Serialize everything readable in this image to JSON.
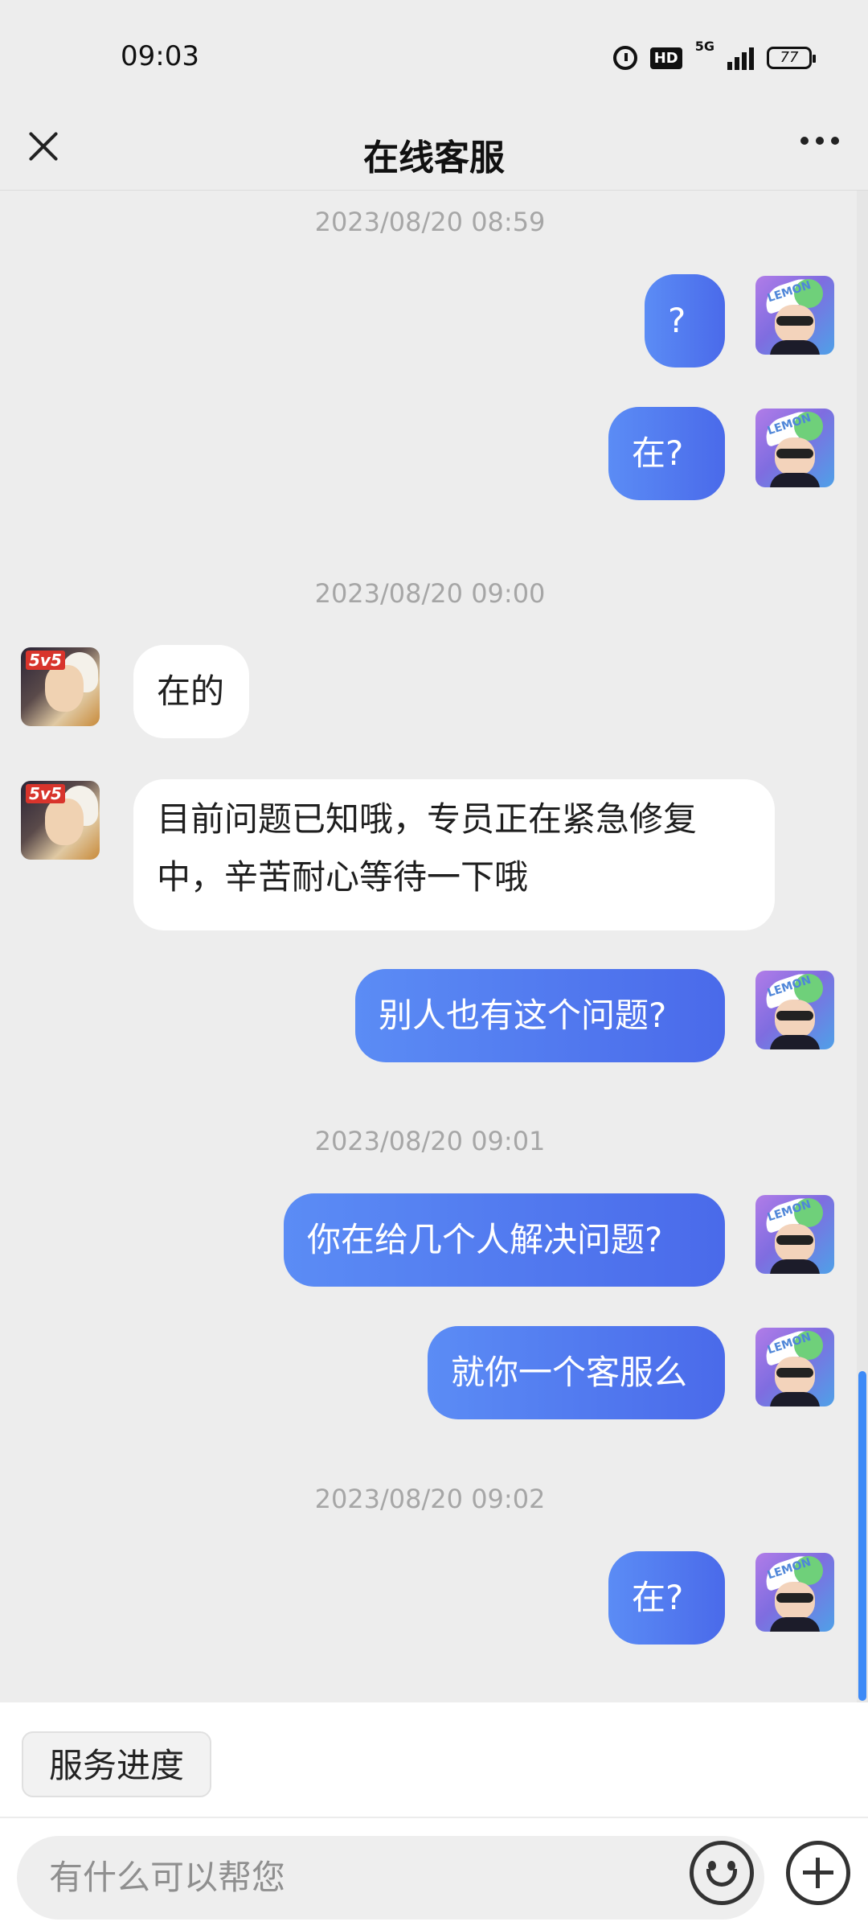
{
  "status_bar": {
    "time": "09:03",
    "hd_label": "HD",
    "network_label": "5G",
    "battery": "77"
  },
  "nav": {
    "title": "在线客服"
  },
  "messages": [
    {
      "type": "timestamp",
      "text": "2023/08/20 08:59"
    },
    {
      "type": "outgoing",
      "text": "?"
    },
    {
      "type": "outgoing",
      "text": "在?"
    },
    {
      "type": "timestamp",
      "text": "2023/08/20 09:00"
    },
    {
      "type": "incoming",
      "text": "在的"
    },
    {
      "type": "incoming",
      "text": "目前问题已知哦，专员正在紧急修复中，辛苦耐心等待一下哦",
      "lines": [
        "目前问题已知哦，专员正在紧急修复",
        "中，辛苦耐心等待一下哦"
      ]
    },
    {
      "type": "outgoing",
      "text": "别人也有这个问题?"
    },
    {
      "type": "timestamp",
      "text": "2023/08/20 09:01"
    },
    {
      "type": "outgoing",
      "text": "你在给几个人解决问题?"
    },
    {
      "type": "outgoing",
      "text": "就你一个客服么"
    },
    {
      "type": "timestamp",
      "text": "2023/08/20 09:02"
    },
    {
      "type": "outgoing",
      "text": "在?"
    }
  ],
  "agent_avatar": {
    "badge": "5v5"
  },
  "user_avatar": {
    "cap_text": "LEMON"
  },
  "quick_actions": [
    {
      "label": "服务进度"
    }
  ],
  "input": {
    "placeholder": "有什么可以帮您"
  },
  "icons": {
    "close": "close-icon",
    "more": "more-icon",
    "emoji": "emoji-icon",
    "plus": "plus-icon"
  },
  "colors": {
    "outgoing_bubble_start": "#5b8cf5",
    "outgoing_bubble_end": "#4a6aea",
    "incoming_bubble": "#ffffff",
    "background": "#ededed",
    "scroll_thumb": "#3d8af7"
  }
}
